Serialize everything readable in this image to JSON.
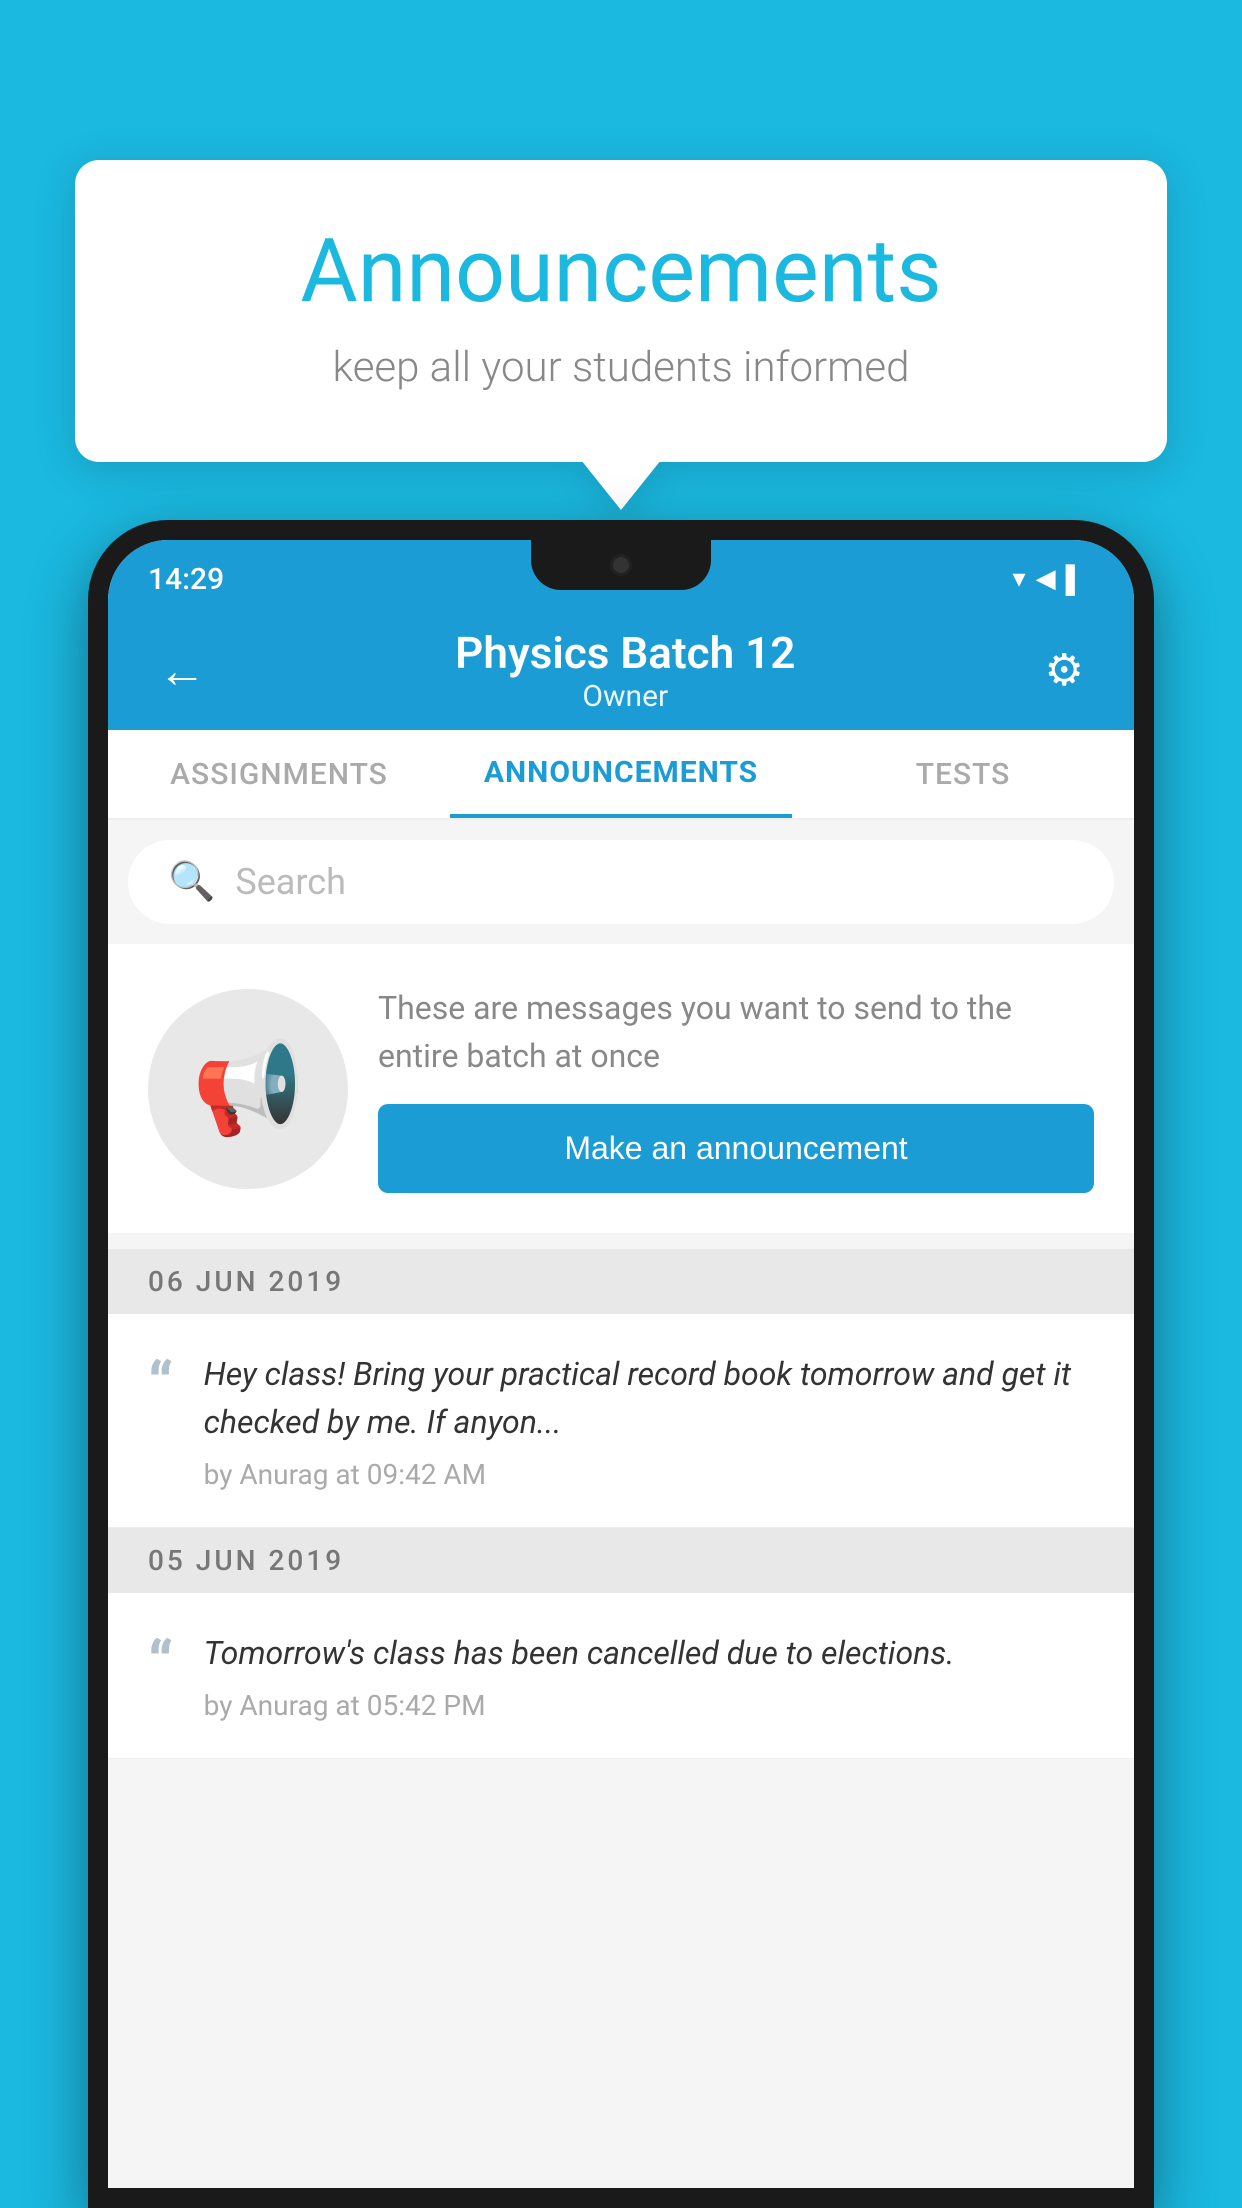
{
  "page": {
    "background_color": "#1BB8E0"
  },
  "hero": {
    "title": "Announcements",
    "subtitle": "keep all your students informed"
  },
  "status_bar": {
    "time": "14:29",
    "icons": [
      "▾",
      "◀",
      "▌"
    ]
  },
  "app_bar": {
    "back_label": "←",
    "title": "Physics Batch 12",
    "subtitle": "Owner",
    "settings_label": "⚙"
  },
  "tabs": [
    {
      "label": "ASSIGNMENTS",
      "active": false
    },
    {
      "label": "ANNOUNCEMENTS",
      "active": true
    },
    {
      "label": "TESTS",
      "active": false
    }
  ],
  "search": {
    "placeholder": "Search"
  },
  "announcement_prompt": {
    "description": "These are messages you want to send to the entire batch at once",
    "button_label": "Make an announcement"
  },
  "dates": [
    {
      "date_label": "06  JUN  2019",
      "items": [
        {
          "message": "Hey class! Bring your practical record book tomorrow and get it checked by me. If anyon...",
          "meta": "by Anurag at 09:42 AM"
        }
      ]
    },
    {
      "date_label": "05  JUN  2019",
      "items": [
        {
          "message": "Tomorrow's class has been cancelled due to elections.",
          "meta": "by Anurag at 05:42 PM"
        }
      ]
    }
  ]
}
